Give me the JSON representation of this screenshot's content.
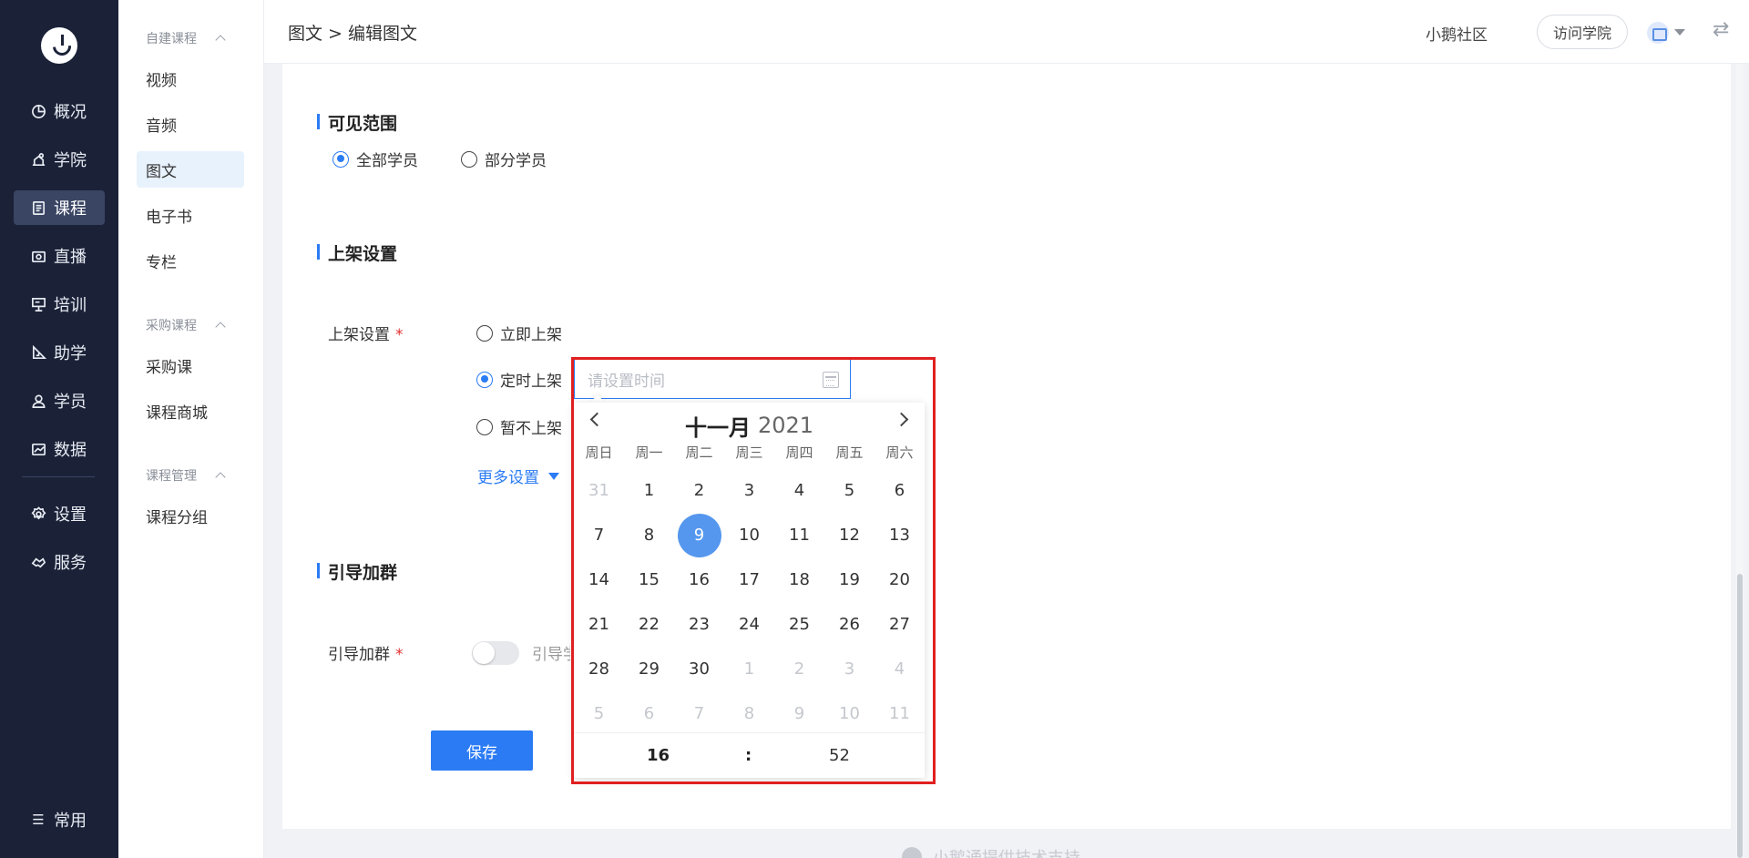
{
  "nav": {
    "items": [
      {
        "key": "overview",
        "label": "概况",
        "icon": "pie-chart-icon"
      },
      {
        "key": "academy",
        "label": "学院",
        "icon": "academy-icon"
      },
      {
        "key": "course",
        "label": "课程",
        "icon": "book-icon",
        "active": true
      },
      {
        "key": "live",
        "label": "直播",
        "icon": "live-icon"
      },
      {
        "key": "training",
        "label": "培训",
        "icon": "training-icon"
      },
      {
        "key": "assist",
        "label": "助学",
        "icon": "ruler-icon"
      },
      {
        "key": "student",
        "label": "学员",
        "icon": "user-icon"
      },
      {
        "key": "data",
        "label": "数据",
        "icon": "chart-icon"
      },
      {
        "key": "settings",
        "label": "设置",
        "icon": "gear-icon"
      },
      {
        "key": "service",
        "label": "服务",
        "icon": "handshake-icon"
      }
    ],
    "common_label": "常用"
  },
  "subnav": {
    "group1": "自建课程",
    "group1_items": [
      "视频",
      "音频",
      "图文",
      "电子书",
      "专栏"
    ],
    "group2": "采购课程",
    "group2_items": [
      "采购课",
      "课程商城"
    ],
    "group3": "课程管理",
    "group3_items": [
      "课程分组"
    ]
  },
  "header": {
    "breadcrumb": "图文 > 编辑图文",
    "community": "小鹅社区",
    "visit_btn": "访问学院",
    "switch_icon": "⇄"
  },
  "visibility": {
    "title": "可见范围",
    "option_all": "全部学员",
    "option_part": "部分学员"
  },
  "shelf": {
    "title": "上架设置",
    "label": "上架设置",
    "required": "*",
    "opt_now": "立即上架",
    "opt_timed": "定时上架",
    "opt_not": "暂不上架",
    "more": "更多设置"
  },
  "group_join": {
    "title": "引导加群",
    "label": "引导加群",
    "required": "*",
    "toggle_text": "引导学"
  },
  "save_label": "保存",
  "footer_note": "小鹅通提供技术支持",
  "datepicker": {
    "placeholder": "请设置时间",
    "month": "十一月",
    "year": "2021",
    "weekdays": [
      "周日",
      "周一",
      "周二",
      "周三",
      "周四",
      "周五",
      "周六"
    ],
    "weeks": [
      [
        {
          "d": "31",
          "m": true
        },
        {
          "d": "1"
        },
        {
          "d": "2"
        },
        {
          "d": "3"
        },
        {
          "d": "4"
        },
        {
          "d": "5"
        },
        {
          "d": "6"
        }
      ],
      [
        {
          "d": "7"
        },
        {
          "d": "8"
        },
        {
          "d": "9",
          "s": true
        },
        {
          "d": "10"
        },
        {
          "d": "11"
        },
        {
          "d": "12"
        },
        {
          "d": "13"
        }
      ],
      [
        {
          "d": "14"
        },
        {
          "d": "15"
        },
        {
          "d": "16"
        },
        {
          "d": "17"
        },
        {
          "d": "18"
        },
        {
          "d": "19"
        },
        {
          "d": "20"
        }
      ],
      [
        {
          "d": "21"
        },
        {
          "d": "22"
        },
        {
          "d": "23"
        },
        {
          "d": "24"
        },
        {
          "d": "25"
        },
        {
          "d": "26"
        },
        {
          "d": "27"
        }
      ],
      [
        {
          "d": "28"
        },
        {
          "d": "29"
        },
        {
          "d": "30"
        },
        {
          "d": "1",
          "m": true
        },
        {
          "d": "2",
          "m": true
        },
        {
          "d": "3",
          "m": true
        },
        {
          "d": "4",
          "m": true
        }
      ],
      [
        {
          "d": "5",
          "m": true
        },
        {
          "d": "6",
          "m": true
        },
        {
          "d": "7",
          "m": true
        },
        {
          "d": "8",
          "m": true
        },
        {
          "d": "9",
          "m": true
        },
        {
          "d": "10",
          "m": true
        },
        {
          "d": "11",
          "m": true
        }
      ]
    ],
    "hour": "16",
    "separator": ":",
    "minute": "52"
  },
  "colors": {
    "accent": "#2b7bf4",
    "sidebar_bg": "#1b2238",
    "selected_day": "#5597ee",
    "highlight_border": "#e02020"
  }
}
